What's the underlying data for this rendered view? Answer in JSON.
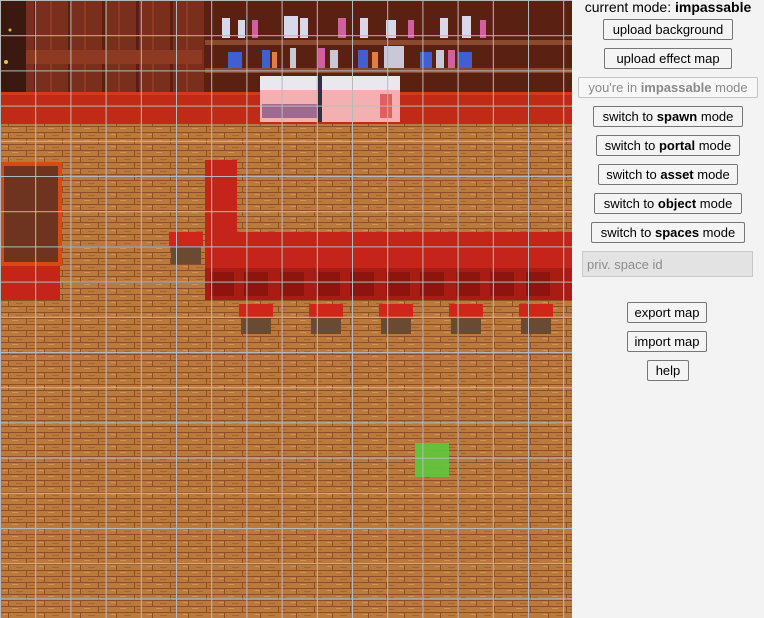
{
  "panel": {
    "mode_prefix": "current mode: ",
    "mode_value": "impassable",
    "upload_background": "upload background",
    "upload_effect_map": "upload effect map",
    "current_mode_button": {
      "prefix": "you're in ",
      "mode": "impassable",
      "suffix": " mode"
    },
    "mode_buttons": [
      {
        "prefix": "switch to ",
        "mode": "spawn",
        "suffix": " mode"
      },
      {
        "prefix": "switch to ",
        "mode": "portal",
        "suffix": " mode"
      },
      {
        "prefix": "switch to ",
        "mode": "asset",
        "suffix": " mode"
      },
      {
        "prefix": "switch to ",
        "mode": "object",
        "suffix": " mode"
      },
      {
        "prefix": "switch to ",
        "mode": "spaces",
        "suffix": " mode"
      }
    ],
    "space_id_placeholder": "priv. space id",
    "export_map": "export map",
    "import_map": "import map",
    "help": "help"
  },
  "map": {
    "grid_columns": 16,
    "grid_rows": 18,
    "highlighted_cell": {
      "col": 12,
      "row": 13
    },
    "colors": {
      "floor": "#b8763a",
      "floor_line": "#8e4e22",
      "carpet": "#c8281c",
      "wall": "#6e2b1e",
      "grid": "#b4b4b4",
      "highlight": "#5fc23a"
    }
  }
}
